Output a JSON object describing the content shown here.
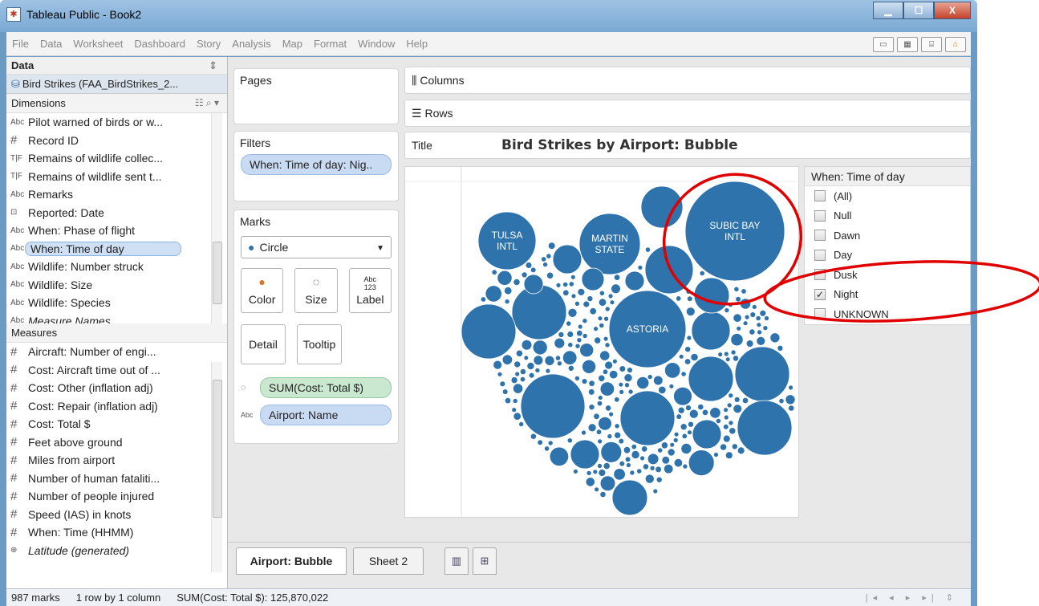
{
  "window": {
    "title": "Tableau Public - Book2",
    "app_icon": "tableau-icon",
    "controls": [
      "minimize",
      "maximize",
      "close"
    ]
  },
  "menu": [
    "File",
    "Data",
    "Worksheet",
    "Dashboard",
    "Story",
    "Analysis",
    "Map",
    "Format",
    "Window",
    "Help"
  ],
  "data_pane": {
    "header": "Data",
    "source": "Bird Strikes (FAA_BirdStrikes_2...",
    "dimensions_label": "Dimensions",
    "dimensions": [
      {
        "type": "Abc",
        "label": "Pilot warned of birds or w..."
      },
      {
        "type": "#",
        "label": "Record ID"
      },
      {
        "type": "T|F",
        "label": "Remains of wildlife collec..."
      },
      {
        "type": "T|F",
        "label": "Remains of wildlife sent t..."
      },
      {
        "type": "Abc",
        "label": "Remarks"
      },
      {
        "type": "date",
        "label": "Reported: Date"
      },
      {
        "type": "Abc",
        "label": "When: Phase of flight"
      },
      {
        "type": "Abc",
        "label": "When: Time of day"
      },
      {
        "type": "Abc",
        "label": "Wildlife: Number struck"
      },
      {
        "type": "Abc",
        "label": "Wildlife: Size"
      },
      {
        "type": "Abc",
        "label": "Wildlife: Species"
      },
      {
        "type": "Abc",
        "label": "Measure Names"
      }
    ],
    "measures_label": "Measures",
    "measures": [
      {
        "type": "#",
        "label": "Aircraft: Number of engi..."
      },
      {
        "type": "#",
        "label": "Cost: Aircraft time out of ..."
      },
      {
        "type": "#",
        "label": "Cost: Other (inflation adj)"
      },
      {
        "type": "#",
        "label": "Cost: Repair (inflation adj)"
      },
      {
        "type": "#",
        "label": "Cost: Total $"
      },
      {
        "type": "#",
        "label": "Feet above ground"
      },
      {
        "type": "#",
        "label": "Miles from airport"
      },
      {
        "type": "#",
        "label": "Number of human fataliti..."
      },
      {
        "type": "#",
        "label": "Number of people injured"
      },
      {
        "type": "#",
        "label": "Speed (IAS) in knots"
      },
      {
        "type": "#",
        "label": "When: Time (HHMM)"
      },
      {
        "type": "globe",
        "label": "Latitude (generated)"
      }
    ]
  },
  "shelves": {
    "pages": "Pages",
    "filters": "Filters",
    "filter_pill": "When: Time of day: Nig..",
    "marks": "Marks",
    "mark_type": "Circle",
    "mark_buttons": [
      "Color",
      "Size",
      "Label",
      "Detail",
      "Tooltip"
    ],
    "label_icon_text": "Abc 123",
    "size_pill": "SUM(Cost: Total $)",
    "label_pill": "Airport: Name",
    "columns": "Columns",
    "rows": "Rows",
    "title_label": "Title",
    "title_value": "Bird Strikes by Airport: Bubble"
  },
  "legend": {
    "title": "When: Time of day",
    "items": [
      {
        "label": "(All)",
        "checked": false
      },
      {
        "label": "Null",
        "checked": false
      },
      {
        "label": "Dawn",
        "checked": false
      },
      {
        "label": "Day",
        "checked": false
      },
      {
        "label": "Dusk",
        "checked": false
      },
      {
        "label": "Night",
        "checked": true
      },
      {
        "label": "UNKNOWN",
        "checked": false
      }
    ]
  },
  "chart_data": {
    "type": "scatter",
    "mark": "packed-bubble",
    "color": "#2f73ad",
    "labeled_bubbles": [
      "TULSA INTL",
      "MARTIN STATE",
      "SUBIC BAY INTL",
      "ASTORIA"
    ],
    "size_measure": "SUM(Cost: Total $)",
    "label_field": "Airport: Name",
    "mark_count": 987
  },
  "tabs": {
    "sheet1": "Airport: Bubble",
    "sheet2": "Sheet 2"
  },
  "status": {
    "marks": "987 marks",
    "rows_cols": "1 row by 1 column",
    "sum": "SUM(Cost: Total $): 125,870,022"
  },
  "annotation_color": "#e00000"
}
